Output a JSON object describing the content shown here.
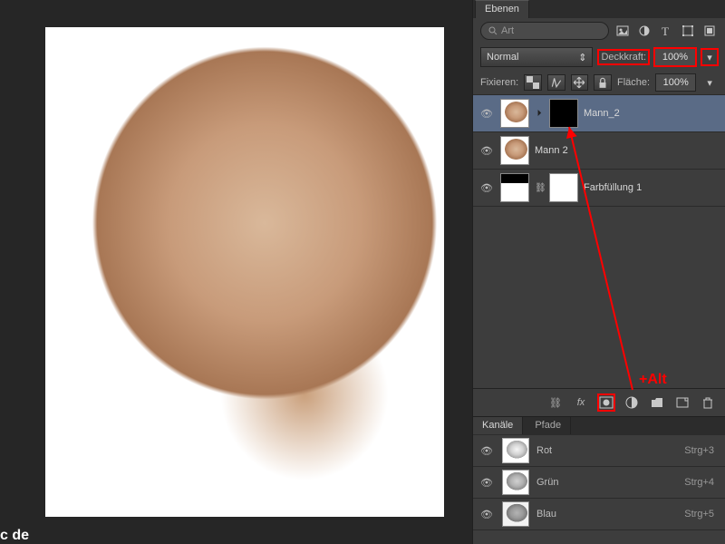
{
  "panel_tab": "Ebenen",
  "search": {
    "placeholder": "Art"
  },
  "blend_mode": "Normal",
  "opacity": {
    "label": "Deckkraft:",
    "value": "100%"
  },
  "lock_label": "Fixieren:",
  "fill": {
    "label": "Fläche:",
    "value": "100%"
  },
  "layers": [
    {
      "name": "Mann_2",
      "selected": true,
      "visible": true,
      "has_mask": true,
      "mask_black": true
    },
    {
      "name": "Mann 2",
      "selected": false,
      "visible": true,
      "has_mask": false
    },
    {
      "name": "Farbfüllung 1",
      "selected": false,
      "visible": true,
      "has_mask": true,
      "fill_layer": true
    }
  ],
  "panel2_tabs": {
    "active": "Kanäle",
    "other": "Pfade"
  },
  "channels": [
    {
      "name": "Rot",
      "shortcut": "Strg+3"
    },
    {
      "name": "Grün",
      "shortcut": "Strg+4"
    },
    {
      "name": "Blau",
      "shortcut": "Strg+5"
    }
  ],
  "annotation": "+Alt",
  "watermark": "c de"
}
